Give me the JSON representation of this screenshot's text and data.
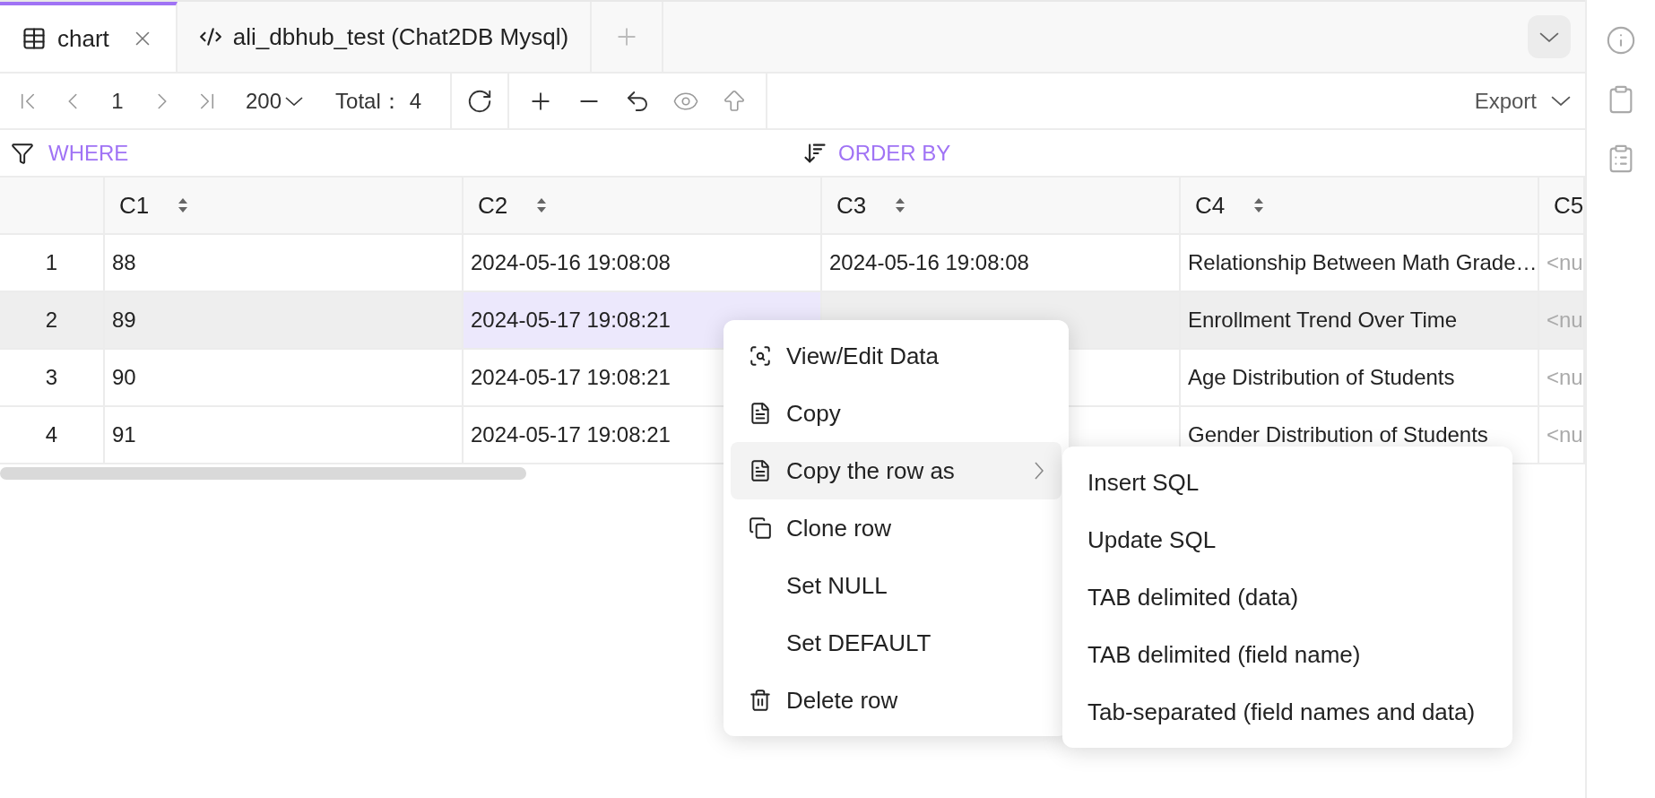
{
  "tabs": [
    {
      "label": "chart",
      "kind": "table",
      "selected": true,
      "closable": true
    },
    {
      "label": "ali_dbhub_test (Chat2DB Mysql)",
      "kind": "console",
      "selected": false,
      "closable": false
    }
  ],
  "toolbar": {
    "page": "1",
    "page_size": "200",
    "total_label": "Total：",
    "total": "4",
    "export": "Export"
  },
  "filters": {
    "where": "WHERE",
    "order_by": "ORDER BY"
  },
  "table": {
    "columns": [
      {
        "label": "C1",
        "sortable": true
      },
      {
        "label": "C2",
        "sortable": true
      },
      {
        "label": "C3",
        "sortable": true
      },
      {
        "label": "C4",
        "sortable": true
      },
      {
        "label": "C5"
      }
    ],
    "rows": [
      {
        "number": "1",
        "selected": false,
        "cells": [
          {
            "text": "88",
            "kind": "value",
            "selected": false
          },
          {
            "text": "2024-05-16 19:08:08",
            "kind": "value",
            "selected": false
          },
          {
            "text": "2024-05-16 19:08:08",
            "kind": "value",
            "selected": false
          },
          {
            "text": "Relationship Between Math Grade…",
            "kind": "value",
            "selected": false
          },
          {
            "text": "<nu",
            "kind": "null",
            "selected": false
          }
        ]
      },
      {
        "number": "2",
        "selected": true,
        "cells": [
          {
            "text": "89",
            "kind": "value",
            "selected": false
          },
          {
            "text": "2024-05-17 19:08:21",
            "kind": "value",
            "selected": true
          },
          null,
          {
            "text": "Enrollment Trend Over Time",
            "kind": "value",
            "selected": false
          },
          {
            "text": "<nu",
            "kind": "null",
            "selected": false
          }
        ]
      },
      {
        "number": "3",
        "selected": false,
        "cells": [
          {
            "text": "90",
            "kind": "value",
            "selected": false
          },
          {
            "text": "2024-05-17 19:08:21",
            "kind": "value",
            "selected": false
          },
          null,
          {
            "text": "Age Distribution of Students",
            "kind": "value",
            "selected": false
          },
          {
            "text": "<nu",
            "kind": "null",
            "selected": false
          }
        ]
      },
      {
        "number": "4",
        "selected": false,
        "cells": [
          {
            "text": "91",
            "kind": "value",
            "selected": false
          },
          {
            "text": "2024-05-17 19:08:21",
            "kind": "value",
            "selected": false
          },
          null,
          {
            "text": "Gender Distribution of Students",
            "kind": "value",
            "selected": false
          },
          {
            "text": "<nu",
            "kind": "null",
            "selected": false
          }
        ]
      }
    ]
  },
  "context_menu": {
    "items": [
      {
        "label": "View/Edit Data",
        "kind": "view",
        "selected": false,
        "submenu": false
      },
      {
        "label": "Copy",
        "kind": "copy",
        "selected": false,
        "submenu": false
      },
      {
        "label": "Copy the row as",
        "kind": "copy",
        "selected": true,
        "submenu": true
      },
      {
        "label": "Clone row",
        "kind": "clone",
        "selected": false,
        "submenu": false
      },
      {
        "label": "Set NULL",
        "kind": "plain",
        "selected": false,
        "submenu": false
      },
      {
        "label": "Set DEFAULT",
        "kind": "plain",
        "selected": false,
        "submenu": false
      },
      {
        "label": "Delete row",
        "kind": "delete",
        "selected": false,
        "submenu": false
      }
    ],
    "submenu": [
      "Insert SQL",
      "Update SQL",
      "TAB delimited (data)",
      "TAB delimited (field name)",
      "Tab-separated (field names and data)"
    ]
  }
}
